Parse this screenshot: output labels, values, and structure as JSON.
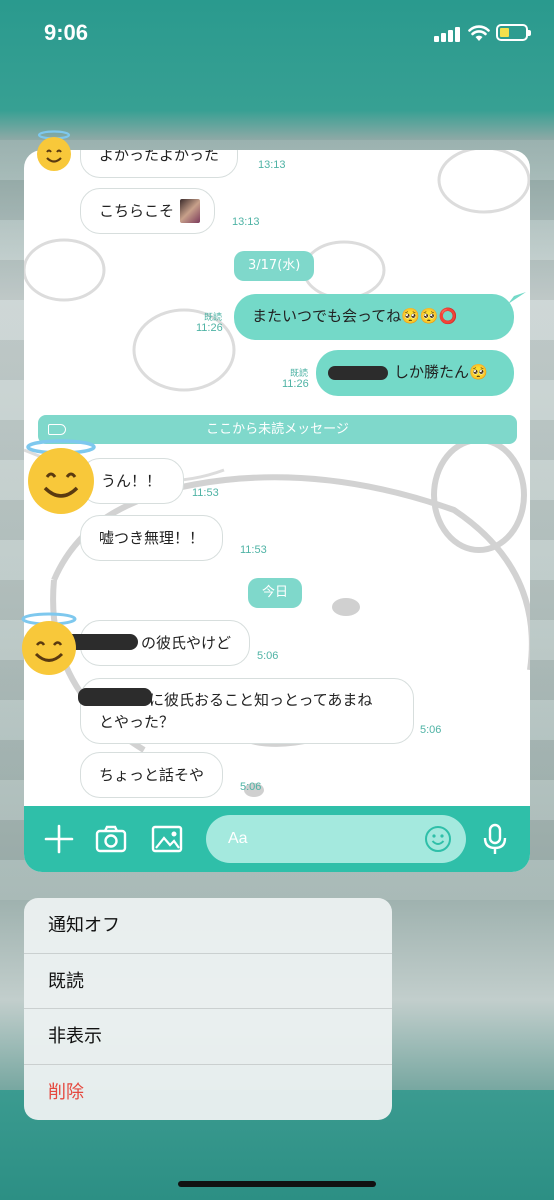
{
  "status_bar": {
    "time": "9:06"
  },
  "chat": {
    "messages": [
      {
        "side": "in",
        "text": "よかったよかった",
        "time": "13:13"
      },
      {
        "side": "in",
        "text": "こちらこそ",
        "time": "13:13"
      },
      {
        "side": "out",
        "text": "またいつでも会ってね🥺🥺⭕",
        "time": "11:26",
        "read": "既読"
      },
      {
        "side": "out",
        "text": "しか勝たん🥺",
        "time": "11:26",
        "read": "既読"
      },
      {
        "side": "in",
        "text": "うん！！",
        "time": "11:53"
      },
      {
        "side": "in",
        "text": "嘘つき無理！！",
        "time": "11:53"
      },
      {
        "side": "in",
        "text": "の彼氏やけど",
        "time": "5:06"
      },
      {
        "side": "in",
        "text": "に彼氏おること知っとってあまね",
        "text2": "とやった？",
        "time": "5:06"
      },
      {
        "side": "in",
        "text": "ちょっと話そや",
        "time": "5:06"
      }
    ],
    "date_separators": [
      "3/17(水)",
      "今日"
    ],
    "unread_divider": "ここから未読メッセージ",
    "input_placeholder": "Aa"
  },
  "icons": {
    "avatar": "halo-smiley-emoji",
    "plus": "plus-icon",
    "camera": "camera-icon",
    "image": "image-icon",
    "emoji": "smiley-icon",
    "mic": "microphone-icon"
  },
  "context_menu": {
    "items": [
      "通知オフ",
      "既読",
      "非表示",
      "削除"
    ]
  },
  "colors": {
    "accent": "#2fbfa9",
    "outgoing_bubble": "#74d9c8",
    "danger": "#e5483e"
  }
}
